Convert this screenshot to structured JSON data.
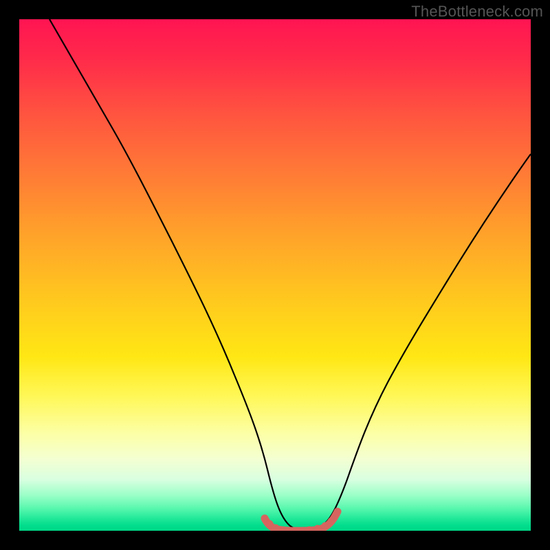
{
  "watermark": "TheBottleneck.com",
  "chart_data": {
    "type": "line",
    "title": "",
    "xlabel": "",
    "ylabel": "",
    "xlim": [
      0,
      100
    ],
    "ylim": [
      0,
      100
    ],
    "series": [
      {
        "name": "bottleneck-curve",
        "x": [
          6,
          10,
          14,
          18,
          22,
          26,
          30,
          34,
          38,
          42,
          46,
          48.5,
          51,
          54,
          57,
          59.5,
          62,
          66,
          70,
          74,
          78,
          82,
          86,
          90,
          94,
          98,
          100
        ],
        "y": [
          100,
          93,
          86,
          79,
          72,
          64,
          56,
          48,
          40,
          31,
          20,
          12,
          5,
          0.5,
          0,
          0.5,
          5,
          13,
          22,
          30,
          37,
          44,
          51,
          57,
          63,
          69,
          72
        ]
      },
      {
        "name": "optimal-flat-marker",
        "x": [
          48,
          49,
          50,
          51,
          52,
          53,
          54,
          55,
          56,
          57,
          58,
          59,
          60,
          61,
          62
        ],
        "y": [
          2.4,
          1.4,
          0.8,
          0.5,
          0.3,
          0.2,
          0.2,
          0.2,
          0.2,
          0.3,
          0.5,
          0.8,
          1.4,
          2.4,
          3.6
        ]
      }
    ],
    "gradient_stops": [
      {
        "pos": 0,
        "color": "#ff1452"
      },
      {
        "pos": 50,
        "color": "#ffd21e"
      },
      {
        "pos": 85,
        "color": "#fdffb0"
      },
      {
        "pos": 100,
        "color": "#00d786"
      }
    ]
  }
}
